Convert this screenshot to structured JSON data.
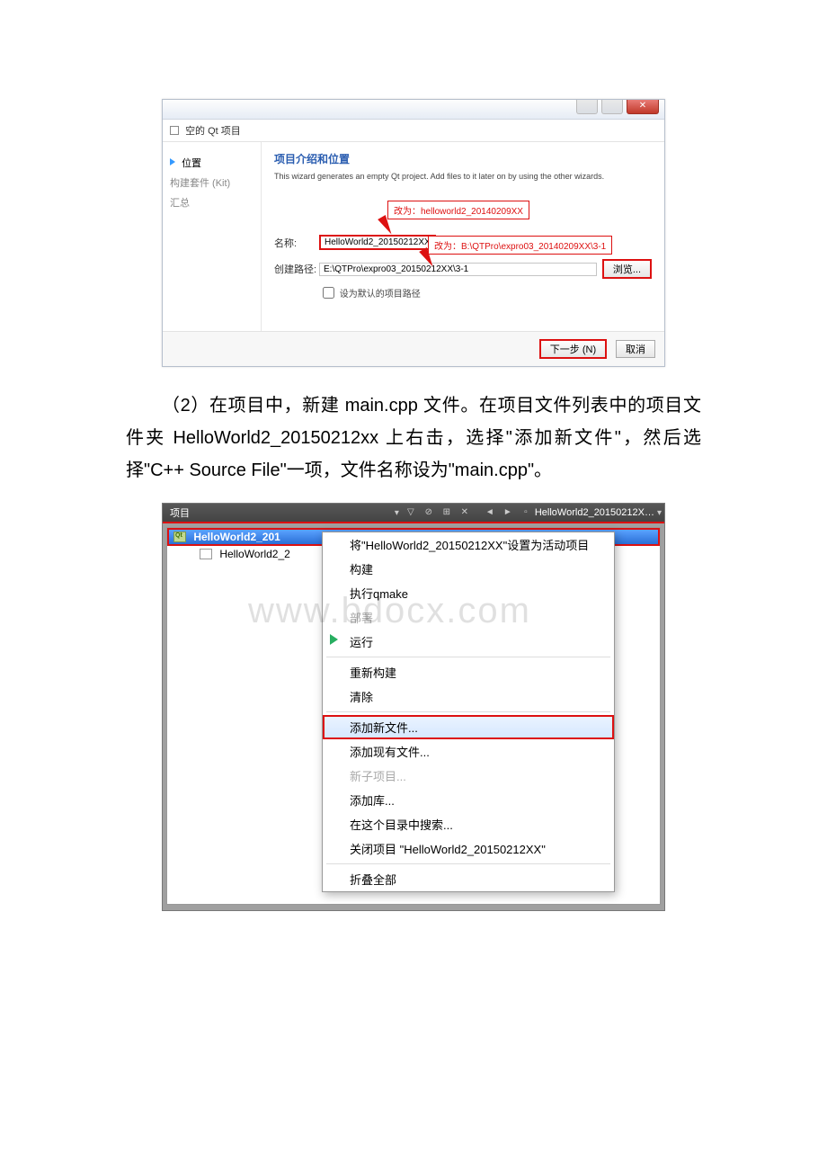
{
  "wizard": {
    "window_title": "空的 Qt 项目",
    "heading": "项目介绍和位置",
    "desc": "This wizard generates an empty Qt project. Add files to it later on by using the other wizards.",
    "steps": {
      "s1": "位置",
      "s2": "构建套件 (Kit)",
      "s3": "汇总"
    },
    "annot1": "改为：helloworld2_20140209XX",
    "annot2": "改为：B:\\QTPro\\expro03_20140209XX\\3-1",
    "name_label": "名称:",
    "name_value": "HelloWorld2_20150212XX",
    "path_label": "创建路径:",
    "path_value": "E:\\QTPro\\expro03_20150212XX\\3-1",
    "browse": "浏览...",
    "default_path_chk": "设为默认的项目路径",
    "next_btn": "下一步 (N)",
    "cancel_btn": "取消"
  },
  "paragraph": "（2）在项目中，新建 main.cpp 文件。在项目文件列表中的项目文件夹 HelloWorld2_20150212xx 上右击，选择\"添加新文件\"，然后选择\"C++ Source File\"一项，文件名称设为\"main.cpp\"。",
  "ide": {
    "pane_label": "项目",
    "open_file": "HelloWorld2_20150212X…",
    "root": "HelloWorld2_201",
    "child": "HelloWorld2_2",
    "menu": {
      "m1": "将\"HelloWorld2_20150212XX\"设置为活动项目",
      "m2": "构建",
      "m3": "执行qmake",
      "m4": "部署",
      "m5": "运行",
      "m6": "重新构建",
      "m7": "清除",
      "m8": "添加新文件...",
      "m9": "添加现有文件...",
      "m10": "新子项目...",
      "m11": "添加库...",
      "m12": "在这个目录中搜索...",
      "m13": "关闭项目 \"HelloWorld2_20150212XX\"",
      "m14": "折叠全部"
    }
  },
  "watermark": "www.bdocx.com"
}
